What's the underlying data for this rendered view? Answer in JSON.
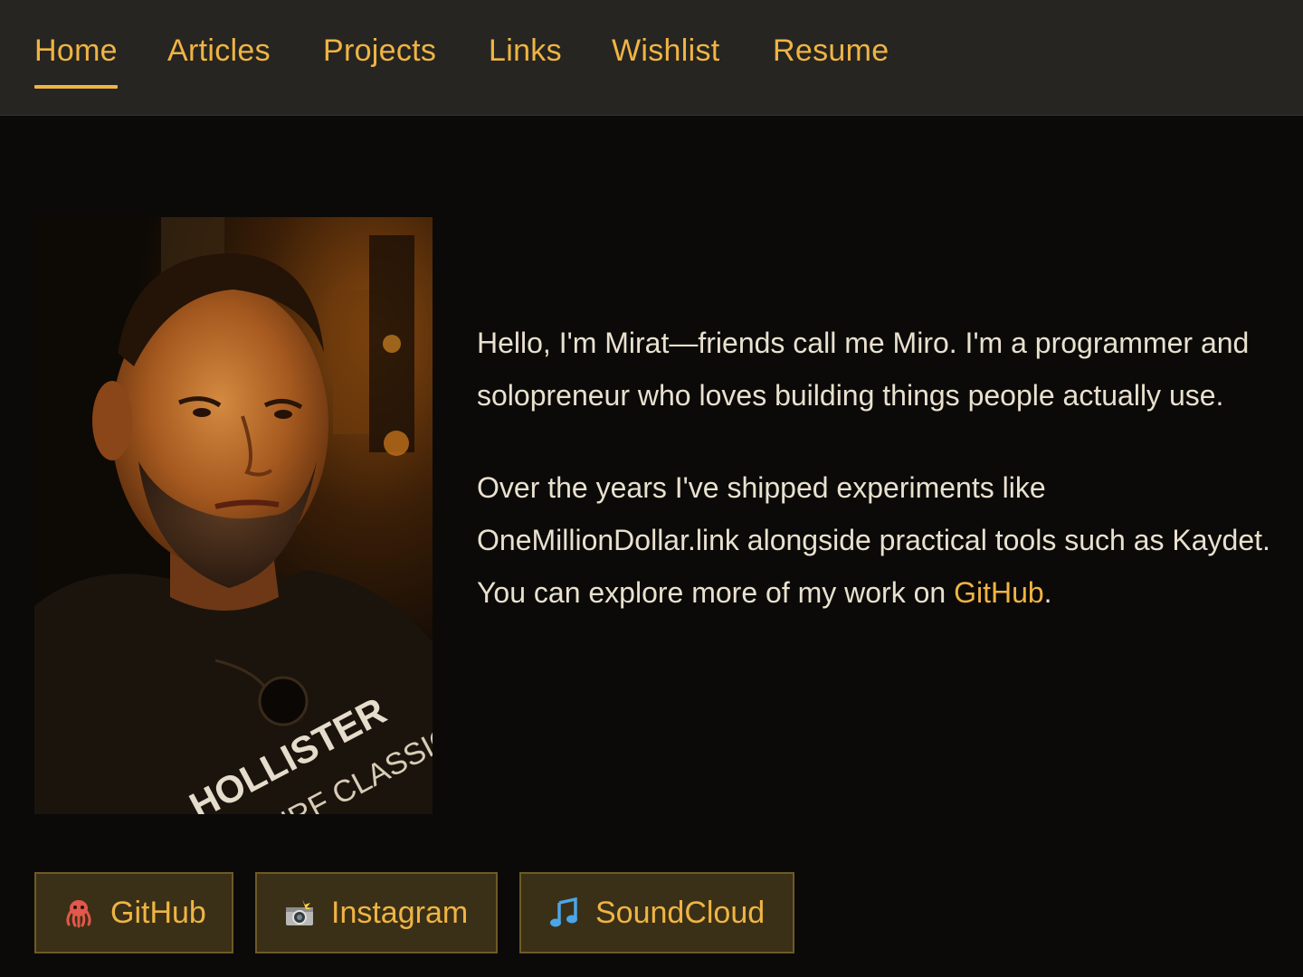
{
  "nav": {
    "items": [
      {
        "label": "Home",
        "active": true
      },
      {
        "label": "Articles"
      },
      {
        "label": "Projects"
      },
      {
        "label": "Links"
      },
      {
        "label": "Wishlist"
      },
      {
        "label": "Resume"
      }
    ]
  },
  "profile": {
    "photo_shirt_text_1": "HOLLISTER",
    "photo_shirt_text_2": "SURF CLASSIC"
  },
  "bio": {
    "paragraph1": "Hello, I'm Mirat—friends call me Miro. I'm a programmer and solopreneur who loves building things people actually use.",
    "paragraph2_before": "Over the years I've shipped experiments like OneMillionDollar.link alongside practical tools such as Kaydet. You can explore more of my work on ",
    "paragraph2_link": "GitHub",
    "paragraph2_after": "."
  },
  "social": [
    {
      "label": "GitHub",
      "icon": "octopus-icon"
    },
    {
      "label": "Instagram",
      "icon": "camera-flash-icon"
    },
    {
      "label": "SoundCloud",
      "icon": "music-note-icon"
    }
  ],
  "colors": {
    "accent": "#f0b444",
    "background": "#0b0a08",
    "nav_background": "#262521",
    "text": "#e9e1cf",
    "button_background": "#3a3017",
    "button_border": "#6e5a26"
  }
}
